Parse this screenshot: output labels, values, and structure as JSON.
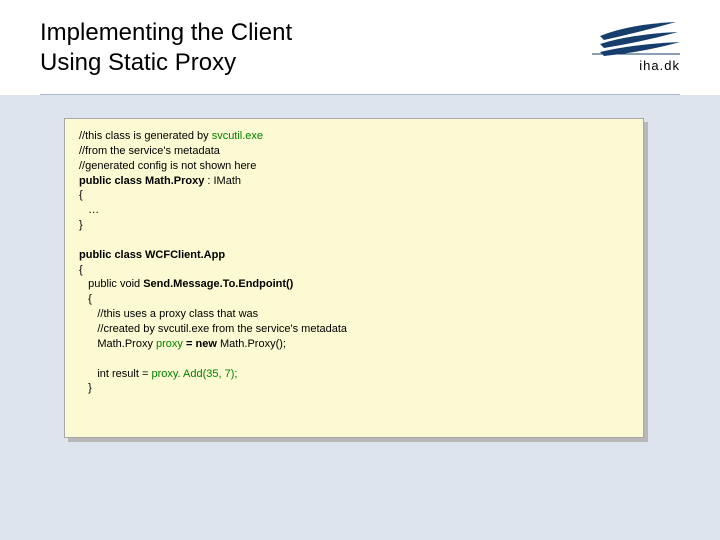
{
  "header": {
    "title_line1": "Implementing the Client",
    "title_line2": "Using Static Proxy",
    "logo_text": "iha.dk"
  },
  "code": {
    "c1": "//this class is generated by ",
    "c1_green": "svcutil.exe",
    "c2": "//from the service's metadata",
    "c3": "//generated config is not shown here",
    "decl1_a": "public class Math.Proxy",
    "decl1_b": " : IMath",
    "brace_open": "{",
    "ellipsis": "   …",
    "brace_close": "}",
    "decl2": "public class WCFClient.App",
    "method_sig_a": "   public void ",
    "method_sig_b": "Send.Message.To.Endpoint()",
    "c4": "      //this uses a proxy class that was",
    "c5": "      //created by svcutil.exe from the service's metadata",
    "new_a": "      Math.Proxy ",
    "new_b": "proxy",
    "new_c": " = ",
    "new_d": "new",
    "new_e": " Math.Proxy();",
    "res_a": "      int result = ",
    "res_b": "proxy. Add(35, 7);",
    "inner_open": "   {",
    "inner_close": "   }"
  }
}
